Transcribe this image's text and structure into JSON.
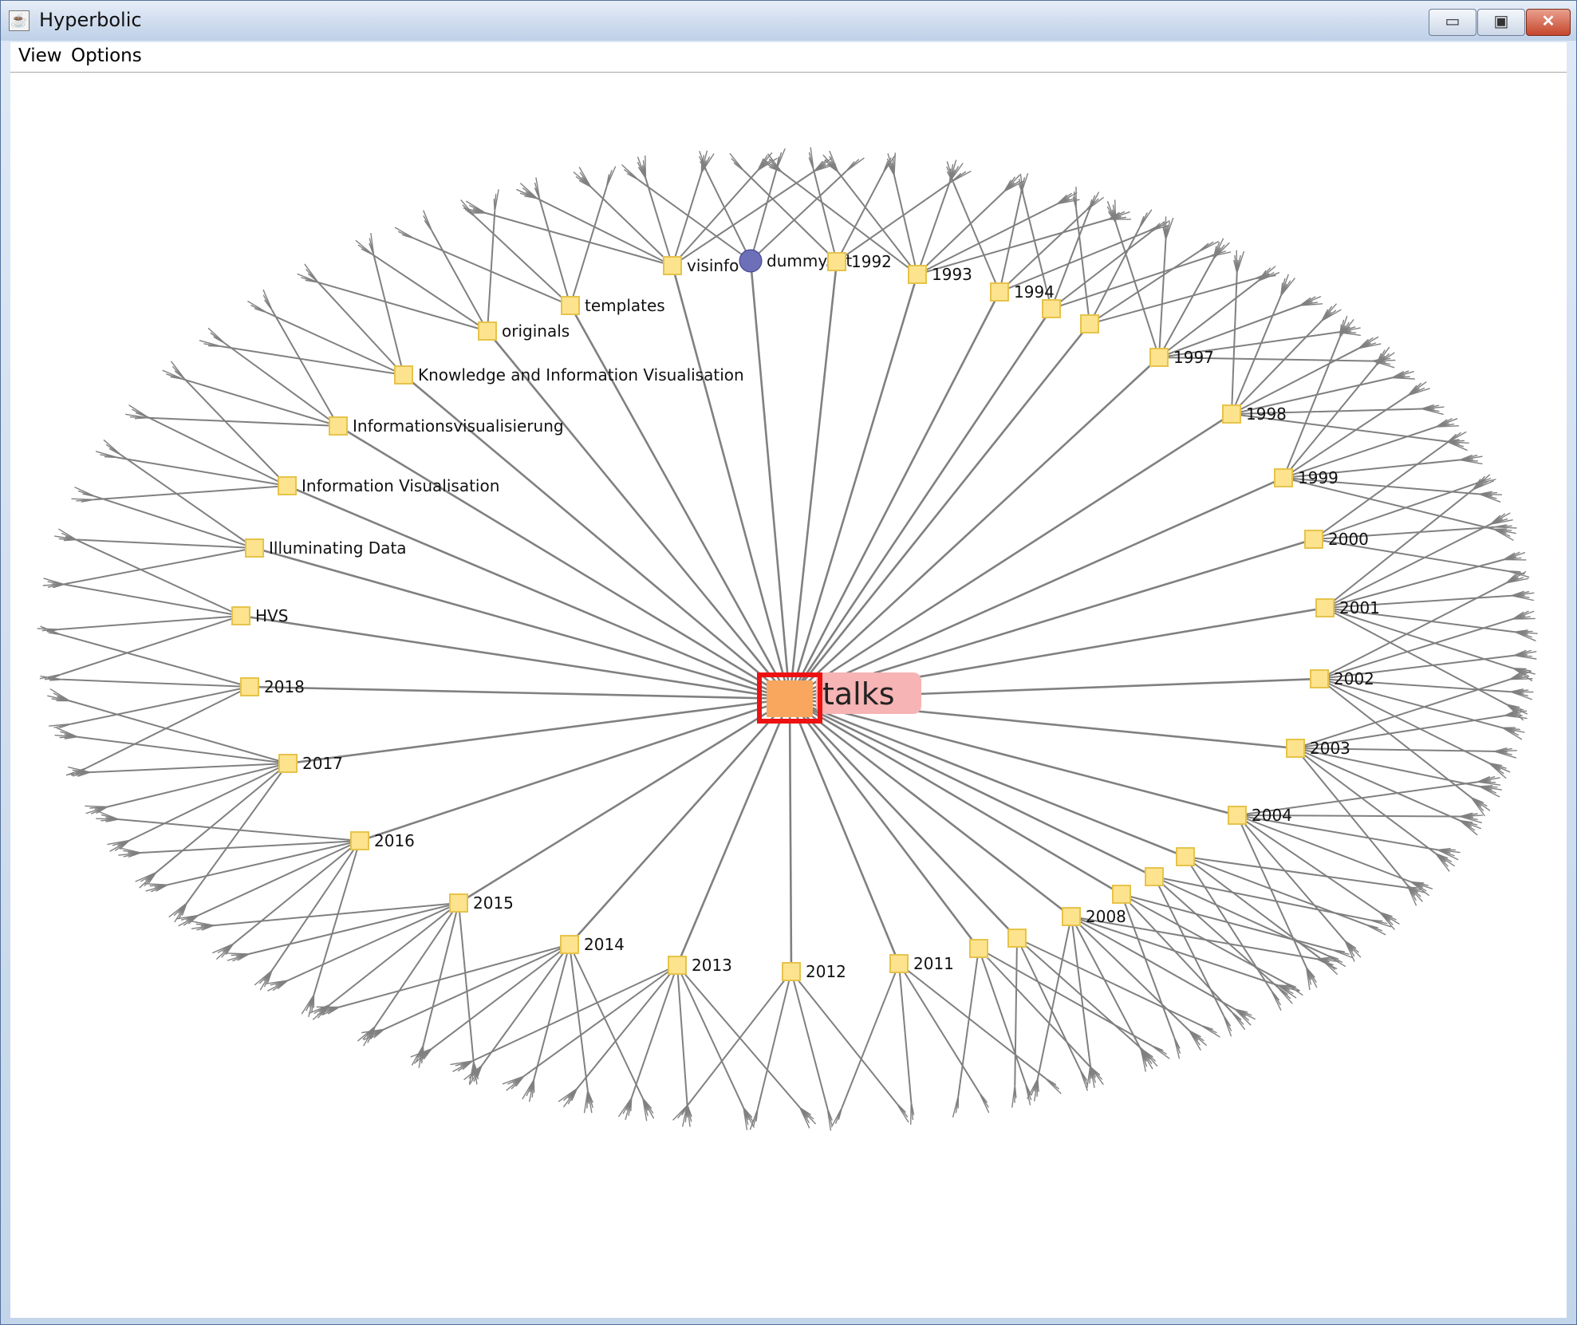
{
  "window": {
    "title": "Hyperbolic",
    "controls": {
      "minimize": "▭",
      "maximize": "▣",
      "close": "✕"
    }
  },
  "menu": {
    "items": [
      "View",
      "Options"
    ]
  },
  "tree": {
    "root": "talks",
    "node_icon": "folder-icon",
    "file_icon": "eclipse-file-icon",
    "colors": {
      "edge": "#808080",
      "folder_fill": "#fde38d",
      "folder_stroke": "#e6c34a",
      "root_fill": "#f9a75e",
      "root_border": "#ee1111",
      "root_highlight": "#f6b4b4"
    },
    "nodes": [
      {
        "label": "visinfo",
        "type": "folder"
      },
      {
        "label": "dummy.txt",
        "type": "file"
      },
      {
        "label": "1992",
        "type": "folder"
      },
      {
        "label": "1993",
        "type": "folder"
      },
      {
        "label": "1994",
        "type": "folder"
      },
      {
        "label": "",
        "type": "folder"
      },
      {
        "label": "",
        "type": "folder"
      },
      {
        "label": "1997",
        "type": "folder"
      },
      {
        "label": "1998",
        "type": "folder"
      },
      {
        "label": "1999",
        "type": "folder"
      },
      {
        "label": "2000",
        "type": "folder"
      },
      {
        "label": "2001",
        "type": "folder"
      },
      {
        "label": "2002",
        "type": "folder"
      },
      {
        "label": "2003",
        "type": "folder"
      },
      {
        "label": "2004",
        "type": "folder"
      },
      {
        "label": "",
        "type": "folder"
      },
      {
        "label": "",
        "type": "folder"
      },
      {
        "label": "",
        "type": "folder"
      },
      {
        "label": "2008",
        "type": "folder"
      },
      {
        "label": "",
        "type": "folder"
      },
      {
        "label": "",
        "type": "folder"
      },
      {
        "label": "2011",
        "type": "folder"
      },
      {
        "label": "2012",
        "type": "folder"
      },
      {
        "label": "2013",
        "type": "folder"
      },
      {
        "label": "2014",
        "type": "folder"
      },
      {
        "label": "2015",
        "type": "folder"
      },
      {
        "label": "2016",
        "type": "folder"
      },
      {
        "label": "2017",
        "type": "folder"
      },
      {
        "label": "2018",
        "type": "folder"
      },
      {
        "label": "HVS",
        "type": "folder"
      },
      {
        "label": "Illuminating Data",
        "type": "folder"
      },
      {
        "label": "Information Visualisation",
        "type": "folder"
      },
      {
        "label": "Informationsvisualisierung",
        "type": "folder"
      },
      {
        "label": "Knowledge and Information Visualisation",
        "type": "folder"
      },
      {
        "label": "originals",
        "type": "folder"
      },
      {
        "label": "templates",
        "type": "folder"
      }
    ]
  }
}
